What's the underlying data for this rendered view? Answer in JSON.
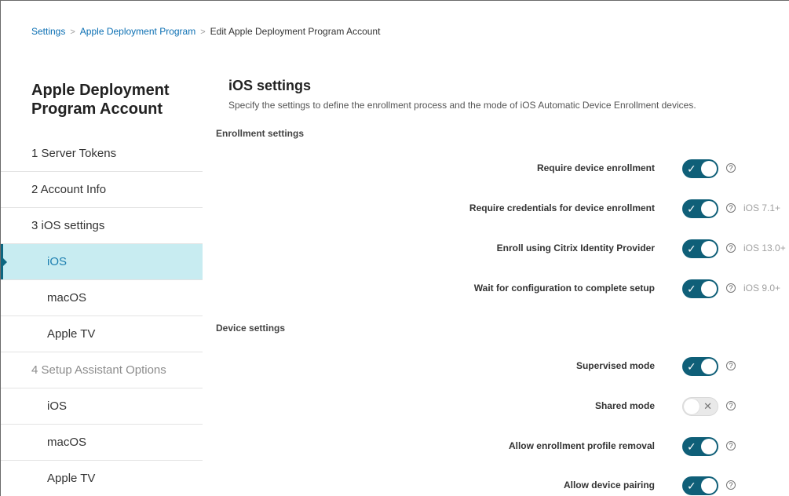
{
  "breadcrumb": {
    "items": [
      "Settings",
      "Apple Deployment Program",
      "Edit Apple Deployment Program Account"
    ],
    "separator": ">"
  },
  "sidebar": {
    "title": "Apple Deployment Program Account",
    "items": [
      {
        "label": "1  Server Tokens"
      },
      {
        "label": "2  Account Info"
      },
      {
        "label": "3  iOS settings"
      },
      {
        "label": "iOS"
      },
      {
        "label": "macOS"
      },
      {
        "label": "Apple TV"
      },
      {
        "label": "4  Setup Assistant Options"
      },
      {
        "label": "iOS"
      },
      {
        "label": "macOS"
      },
      {
        "label": "Apple TV"
      }
    ]
  },
  "main": {
    "title": "iOS settings",
    "description": "Specify the settings to define the enrollment process and the mode of iOS Automatic Device Enrollment devices.",
    "enrollment_section": "Enrollment settings",
    "device_section": "Device settings",
    "help_glyph": "?",
    "enrollment": [
      {
        "label": "Require device enrollment",
        "on": true,
        "version": ""
      },
      {
        "label": "Require credentials for device enrollment",
        "on": true,
        "version": "iOS 7.1+"
      },
      {
        "label": "Enroll using Citrix Identity Provider",
        "on": true,
        "version": "iOS 13.0+"
      },
      {
        "label": "Wait for configuration to complete setup",
        "on": true,
        "version": "iOS 9.0+"
      }
    ],
    "device": [
      {
        "label": "Supervised mode",
        "on": true,
        "version": ""
      },
      {
        "label": "Shared mode",
        "on": false,
        "version": ""
      },
      {
        "label": "Allow enrollment profile removal",
        "on": true,
        "version": ""
      },
      {
        "label": "Allow device pairing",
        "on": true,
        "version": ""
      }
    ]
  },
  "colors": {
    "accent": "#0f5f78",
    "link": "#0b6fb3",
    "active_bg": "#c8ecf1",
    "active_text": "#1d7fb0"
  }
}
